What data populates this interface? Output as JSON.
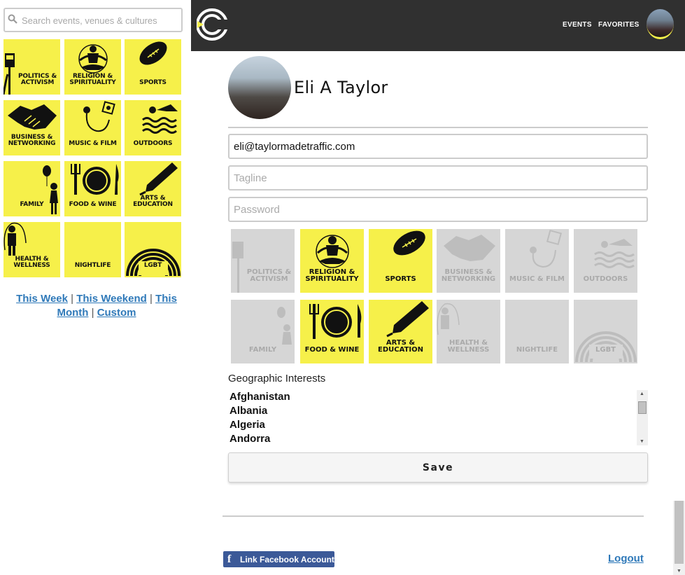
{
  "search": {
    "placeholder": "Search events, venues & cultures"
  },
  "categories": [
    {
      "id": "politics",
      "label": "Politics & Activism",
      "icon": "protest-sign-icon"
    },
    {
      "id": "religion",
      "label": "Religion & Spirituality",
      "icon": "meditation-icon"
    },
    {
      "id": "sports",
      "label": "Sports",
      "icon": "football-icon"
    },
    {
      "id": "business",
      "label": "Business & Networking",
      "icon": "handshake-icon"
    },
    {
      "id": "music",
      "label": "Music & Film",
      "icon": "headphones-icon"
    },
    {
      "id": "outdoors",
      "label": "Outdoors",
      "icon": "swimmer-icon"
    },
    {
      "id": "family",
      "label": "Family",
      "icon": "balloon-child-icon"
    },
    {
      "id": "food",
      "label": "Food & Wine",
      "icon": "plate-fork-knife-icon"
    },
    {
      "id": "arts",
      "label": "Arts & Education",
      "icon": "pen-icon"
    },
    {
      "id": "health",
      "label": "Health & Wellness",
      "icon": "jump-rope-icon"
    },
    {
      "id": "nightlife",
      "label": "Nightlife",
      "icon": "moon-icon"
    },
    {
      "id": "lgbt",
      "label": "LGBT",
      "icon": "rainbow-icon"
    }
  ],
  "time_links": {
    "this_week": "This Week",
    "this_weekend": "This Weekend",
    "this_month": "This Month",
    "custom": "Custom",
    "separator": "|"
  },
  "header": {
    "nav_events": "EVENTS",
    "nav_favorites": "FAVORITES"
  },
  "profile": {
    "name": "Eli A Taylor",
    "email": "eli@taylormadetraffic.com",
    "tagline_placeholder": "Tagline",
    "password_placeholder": "Password"
  },
  "interests": {
    "selected": [
      "religion",
      "sports",
      "food",
      "arts"
    ]
  },
  "geo": {
    "label": "Geographic Interests",
    "options": [
      "Afghanistan",
      "Albania",
      "Algeria",
      "Andorra"
    ]
  },
  "save_label": "Save",
  "facebook_label": "Link Facebook Account",
  "logout_label": "Logout",
  "colors": {
    "accent": "#f6f04a",
    "header": "#303030",
    "link": "#2f79b9",
    "facebook": "#3b5998",
    "tile_off": "#d6d6d6"
  }
}
